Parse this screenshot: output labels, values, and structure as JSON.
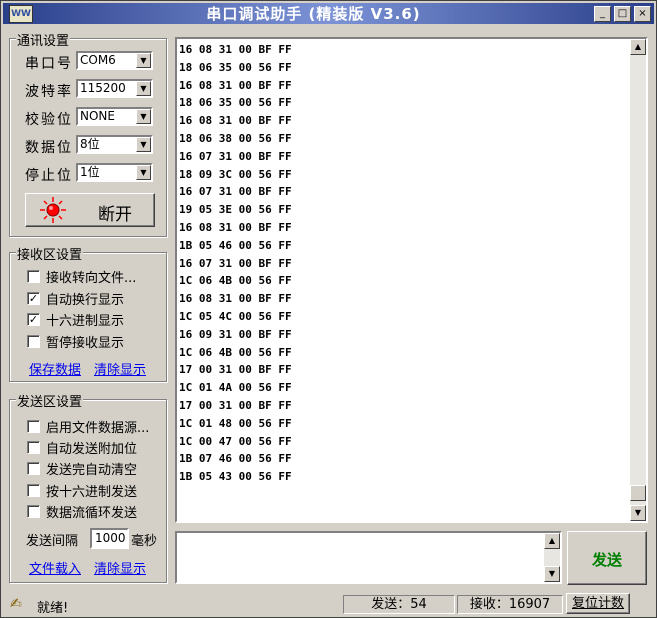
{
  "window": {
    "title": "串口调试助手 (精装版 V3.6)",
    "app_icon": "WW",
    "minimize": "_",
    "maximize": "□",
    "close": "×"
  },
  "comm": {
    "group_title": "通讯设置",
    "port_label": "串口号",
    "port_value": "COM6",
    "baud_label": "波特率",
    "baud_value": "115200",
    "parity_label": "校验位",
    "parity_value": "NONE",
    "data_label": "数据位",
    "data_value": "8位",
    "stop_label": "停止位",
    "stop_value": "1位",
    "connect_button": "断开",
    "status_color": "#ff0000"
  },
  "receive": {
    "group_title": "接收区设置",
    "options": [
      {
        "label": "接收转向文件...",
        "checked": false
      },
      {
        "label": "自动换行显示",
        "checked": true
      },
      {
        "label": "十六进制显示",
        "checked": true
      },
      {
        "label": "暂停接收显示",
        "checked": false
      }
    ],
    "save_link": "保存数据",
    "clear_link": "清除显示",
    "lines": [
      "16 08 31 00 BF FF",
      "18 06 35 00 56 FF",
      "16 08 31 00 BF FF",
      "18 06 35 00 56 FF",
      "16 08 31 00 BF FF",
      "18 06 38 00 56 FF",
      "16 07 31 00 BF FF",
      "18 09 3C 00 56 FF",
      "16 07 31 00 BF FF",
      "19 05 3E 00 56 FF",
      "16 08 31 00 BF FF",
      "1B 05 46 00 56 FF",
      "16 07 31 00 BF FF",
      "1C 06 4B 00 56 FF",
      "16 08 31 00 BF FF",
      "1C 05 4C 00 56 FF",
      "16 09 31 00 BF FF",
      "1C 06 4B 00 56 FF",
      "17 00 31 00 BF FF",
      "1C 01 4A 00 56 FF",
      "17 00 31 00 BF FF",
      "1C 01 48 00 56 FF",
      "1C 00 47 00 56 FF",
      "1B 07 46 00 56 FF",
      "1B 05 43 00 56 FF"
    ]
  },
  "send": {
    "group_title": "发送区设置",
    "options": [
      {
        "label": "启用文件数据源...",
        "checked": false
      },
      {
        "label": "自动发送附加位",
        "checked": false
      },
      {
        "label": "发送完自动清空",
        "checked": false
      },
      {
        "label": "按十六进制发送",
        "checked": false
      },
      {
        "label": "数据流循环发送",
        "checked": false
      }
    ],
    "interval_label": "发送间隔",
    "interval_value": "1000",
    "interval_unit": "毫秒",
    "load_link": "文件载入",
    "clear_link": "清除显示",
    "send_button": "发送",
    "send_color": "#008000",
    "input_value": ""
  },
  "status": {
    "ready": "就绪!",
    "sent": "发送：54",
    "received": "接收：16907",
    "reset_button": "复位计数"
  }
}
